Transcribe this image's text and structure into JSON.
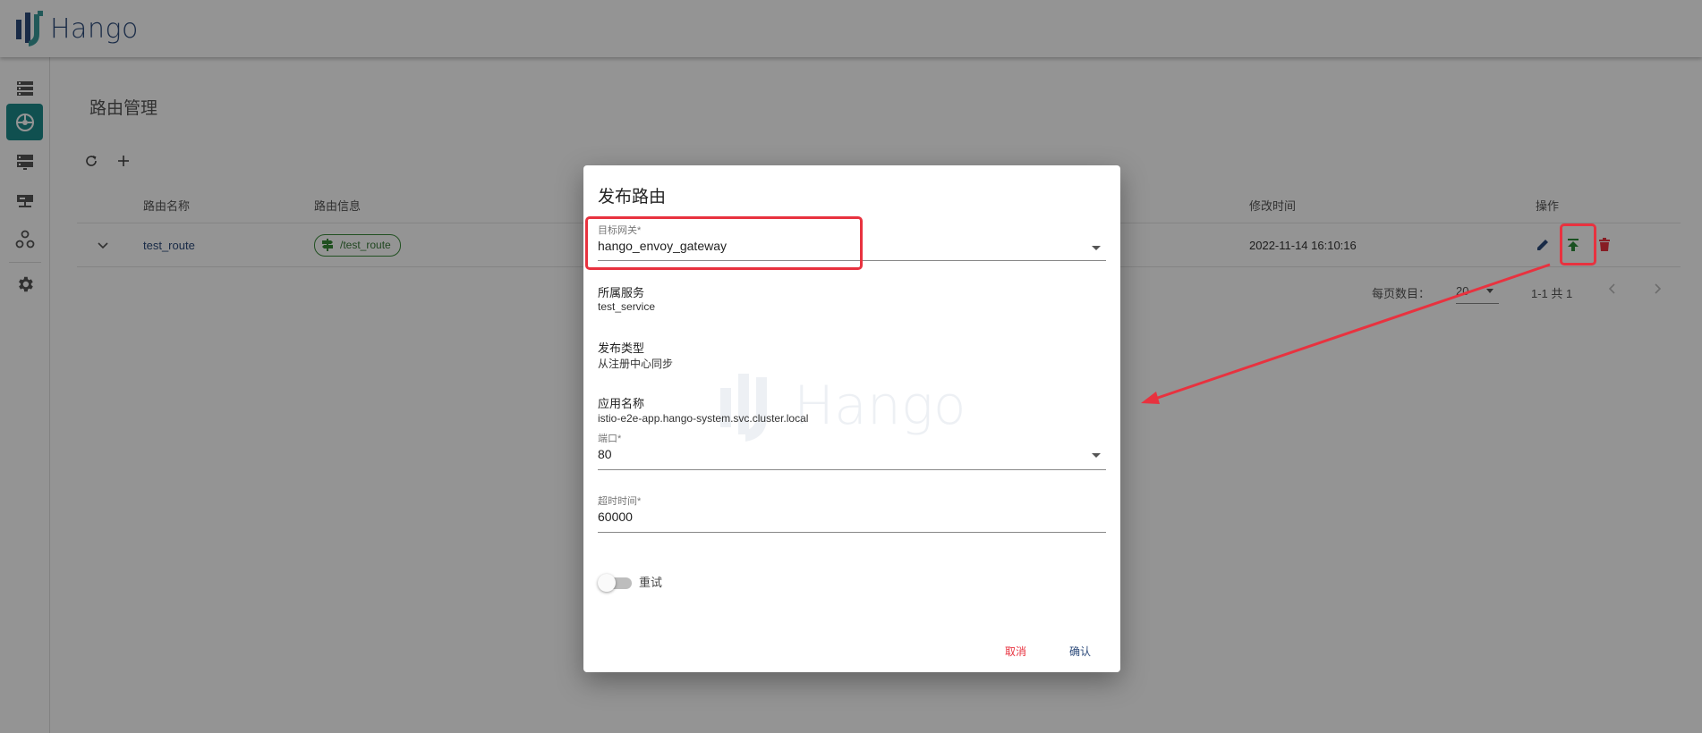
{
  "header": {
    "logo_text": "Hango"
  },
  "sidebar": {
    "items": [
      {
        "icon": "list-icon",
        "active": false
      },
      {
        "icon": "route-icon",
        "active": true
      },
      {
        "icon": "server-icon",
        "active": false
      },
      {
        "icon": "gateway-icon",
        "active": false
      },
      {
        "icon": "cluster-icon",
        "active": false
      },
      {
        "icon": "gear-icon",
        "active": false
      }
    ]
  },
  "page": {
    "title": "路由管理"
  },
  "toolbar": {
    "refresh_icon": "refresh-icon",
    "add_icon": "plus-icon"
  },
  "table": {
    "columns": [
      "路由名称",
      "路由信息",
      "修改时间",
      "操作"
    ],
    "rows": [
      {
        "name": "test_route",
        "path": "/test_route",
        "modified": "2022-11-14 16:10:16"
      }
    ]
  },
  "pager": {
    "per_page_label": "每页数目：",
    "per_page": "20",
    "range": "1-1 共 1"
  },
  "dialog": {
    "title": "发布路由",
    "gateway_label": "目标网关*",
    "gateway_value": "hango_envoy_gateway",
    "service_label": "所属服务",
    "service_value": "test_service",
    "type_label": "发布类型",
    "type_value": "从注册中心同步",
    "app_label": "应用名称",
    "app_value": "istio-e2e-app.hango-system.svc.cluster.local",
    "port_label": "端口*",
    "port_value": "80",
    "timeout_label": "超时时间*",
    "timeout_value": "60000",
    "retry_label": "重试",
    "retry_enabled": false,
    "cancel_label": "取消",
    "confirm_label": "确认",
    "watermark_text": "Hango"
  },
  "colors": {
    "accent": "#1d8a8a",
    "brand": "#2c4a7a",
    "danger": "#e8323f",
    "publish": "#2e8b3a",
    "edit": "#2c4a7a"
  }
}
